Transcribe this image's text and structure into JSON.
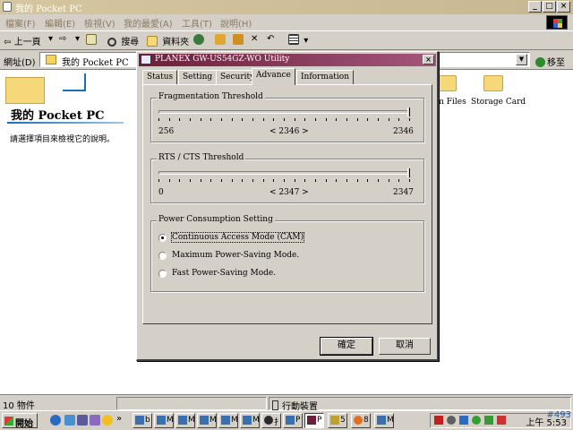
{
  "window": {
    "title": "我的 Pocket PC",
    "minimize": "_",
    "maximize": "□",
    "close": "×"
  },
  "menu": [
    "檔案(F)",
    "編輯(E)",
    "檢視(V)",
    "我的最愛(A)",
    "工具(T)",
    "說明(H)"
  ],
  "toolbar": {
    "back": "上一頁",
    "back_drop": "▾",
    "forward": "⇨",
    "forward_drop": "▾",
    "search": "搜尋",
    "folders": "資料夾"
  },
  "address": {
    "label": "網址(D)",
    "value": "我的 Pocket PC",
    "go": "移至"
  },
  "content": {
    "title": "我的 Pocket PC",
    "description": "請選擇項目來檢視它的說明。",
    "items": [
      {
        "label": "am Files"
      },
      {
        "label": "Storage Card"
      }
    ]
  },
  "status": {
    "count": "10 物件",
    "location": "行動裝置"
  },
  "taskbar": {
    "start": "開始",
    "chevron": "»",
    "tasks": [
      {
        "label": "b"
      },
      {
        "label": "M"
      },
      {
        "label": "M"
      },
      {
        "label": "M"
      },
      {
        "label": "M"
      },
      {
        "label": "M"
      },
      {
        "label": "扌"
      },
      {
        "label": "P"
      },
      {
        "label": "5"
      },
      {
        "label": "8"
      },
      {
        "label": "M"
      }
    ],
    "clock": "上午 5:53",
    "watermark": "#493"
  },
  "dialog": {
    "title": "PLANEX GW-US54GZ-WO Utility",
    "close": "×",
    "tabs": [
      {
        "label": "Status",
        "active": false
      },
      {
        "label": "Setting",
        "active": false
      },
      {
        "label": "Security",
        "active": false
      },
      {
        "label": "Advance",
        "active": true
      },
      {
        "label": "Information",
        "active": false
      }
    ],
    "fragmentation": {
      "label": "Fragmentation Threshold",
      "min": "256",
      "current": "< 2346 >",
      "max": "2346",
      "value_fraction": 1.0
    },
    "rts": {
      "label": "RTS / CTS Threshold",
      "min": "0",
      "current": "< 2347 >",
      "max": "2347",
      "value_fraction": 1.0
    },
    "power": {
      "label": "Power Consumption Setting",
      "options": [
        {
          "label": "Continuous Access Mode (CAM)",
          "selected": true
        },
        {
          "label": "Maximum Power-Saving Mode.",
          "selected": false
        },
        {
          "label": "Fast Power-Saving Mode.",
          "selected": false
        }
      ]
    },
    "ok": "確定",
    "cancel": "取消"
  },
  "colors": {
    "dialog_title": "#6b1f3a",
    "window_title": "#d6c6a0",
    "face": "#d4d0c8"
  }
}
